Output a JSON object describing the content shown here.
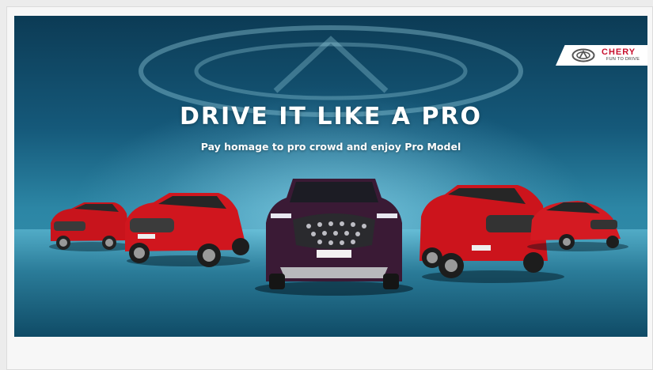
{
  "banner": {
    "headline": "DRIVE IT LIKE A PRO",
    "subheadline": "Pay homage to pro crowd and enjoy Pro Model",
    "brand": {
      "name": "CHERY",
      "tagline": "FUN TO DRIVE"
    },
    "cars": [
      {
        "position": "far-left",
        "color": "#c8141c"
      },
      {
        "position": "left",
        "color": "#d0161e"
      },
      {
        "position": "center",
        "color": "#3a1a35"
      },
      {
        "position": "right",
        "color": "#cc141c"
      },
      {
        "position": "far-right",
        "color": "#d41a22"
      }
    ]
  },
  "colors": {
    "sky_top": "#0c3b55",
    "sky_glow": "#2c86a5",
    "brand_red": "#c8102e"
  }
}
